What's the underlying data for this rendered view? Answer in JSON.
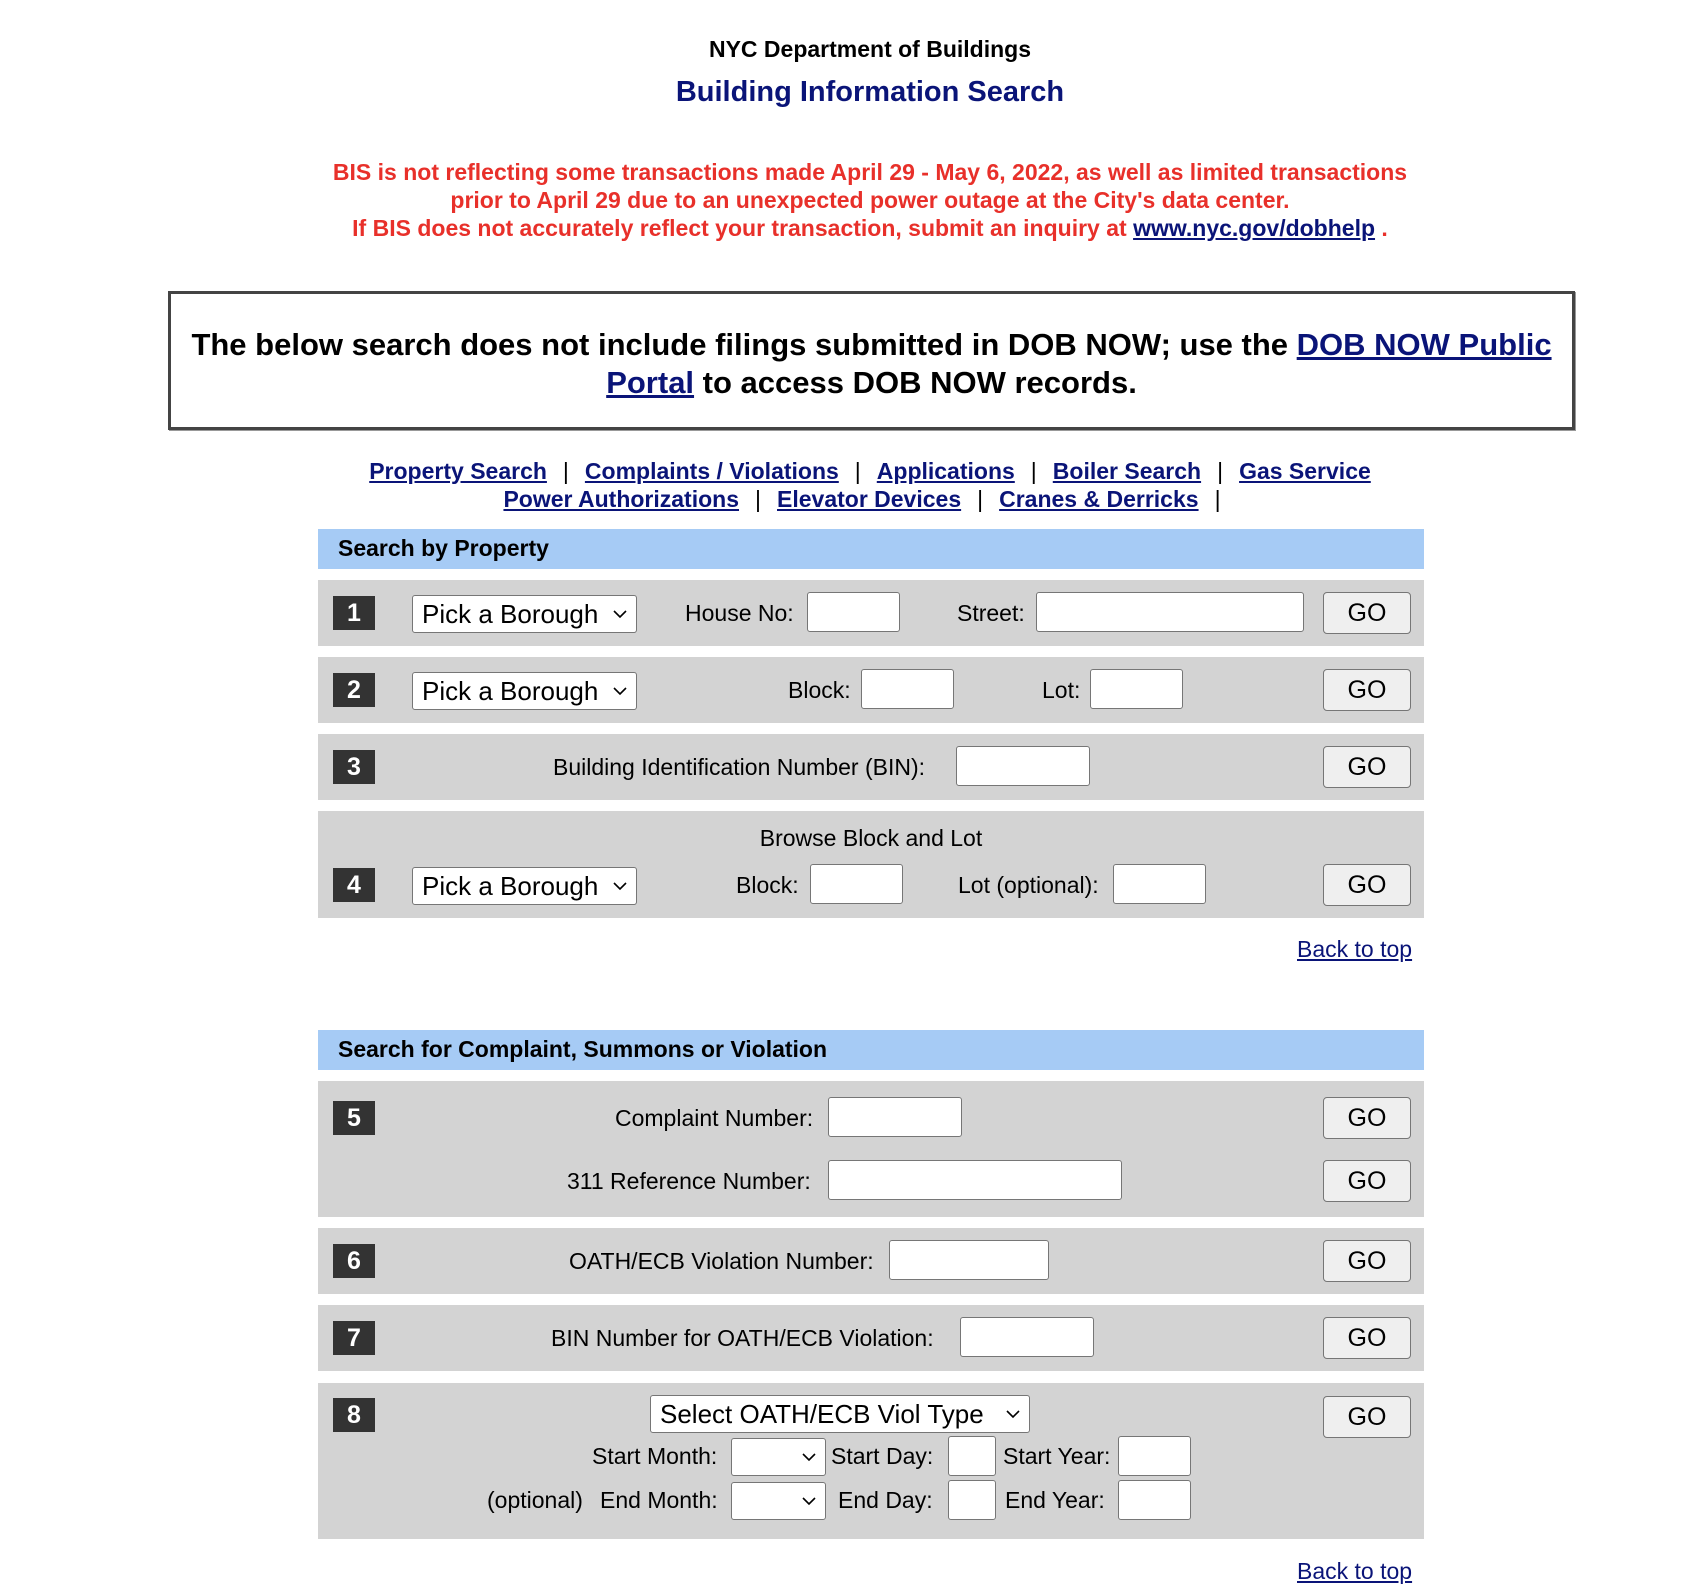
{
  "header": {
    "department": "NYC Department of Buildings",
    "title": "Building Information Search"
  },
  "alert": {
    "line1": "BIS is not reflecting some transactions made April 29 - May 6, 2022, as well as limited transactions",
    "line2": "prior to April 29 due to an unexpected power outage at the City's data center.",
    "line3_prefix": "If BIS does not accurately reflect your transaction, submit an inquiry at",
    "link": "www.nyc.gov/dobhelp",
    "line3_suffix": "."
  },
  "notice": {
    "text_before": "The below search does not include filings submitted in DOB NOW; use the",
    "link": "DOB NOW Public Portal",
    "text_after": "to access DOB NOW records."
  },
  "nav": {
    "items": [
      "Property Search",
      "Complaints / Violations",
      "Applications",
      "Boiler Search",
      "Gas Service",
      "Power Authorizations",
      "Elevator Devices",
      "Cranes & Derricks"
    ],
    "separator": "|"
  },
  "property_section": {
    "title": "Search by Property",
    "row1": {
      "num": "1",
      "borough": "Pick a Borough",
      "house_label": "House No:",
      "street_label": "Street:",
      "go": "GO"
    },
    "row2": {
      "num": "2",
      "borough": "Pick a Borough",
      "block_label": "Block:",
      "lot_label": "Lot:",
      "go": "GO"
    },
    "row3": {
      "num": "3",
      "bin_label": "Building Identification Number (BIN):",
      "go": "GO"
    },
    "row4": {
      "num": "4",
      "title": "Browse Block and Lot",
      "borough": "Pick a Borough",
      "block_label": "Block:",
      "lot_label": "Lot (optional):",
      "go": "GO"
    },
    "back_to_top": "Back to top"
  },
  "complaint_section": {
    "title": "Search for Complaint, Summons or Violation",
    "row5": {
      "num": "5",
      "complaint_label": "Complaint Number:",
      "ref_label": "311 Reference Number:",
      "go": "GO"
    },
    "row6": {
      "num": "6",
      "oath_label": "OATH/ECB Violation Number:",
      "go": "GO"
    },
    "row7": {
      "num": "7",
      "bin_label": "BIN Number for OATH/ECB Violation:",
      "go": "GO"
    },
    "row8": {
      "num": "8",
      "viol_type": "Select OATH/ECB Viol Type",
      "start_month_label": "Start Month:",
      "start_day_label": "Start Day:",
      "start_year_label": "Start Year:",
      "optional_label": "(optional)",
      "end_month_label": "End Month:",
      "end_day_label": "End Day:",
      "end_year_label": "End Year:",
      "go": "GO"
    },
    "back_to_top": "Back to top"
  }
}
